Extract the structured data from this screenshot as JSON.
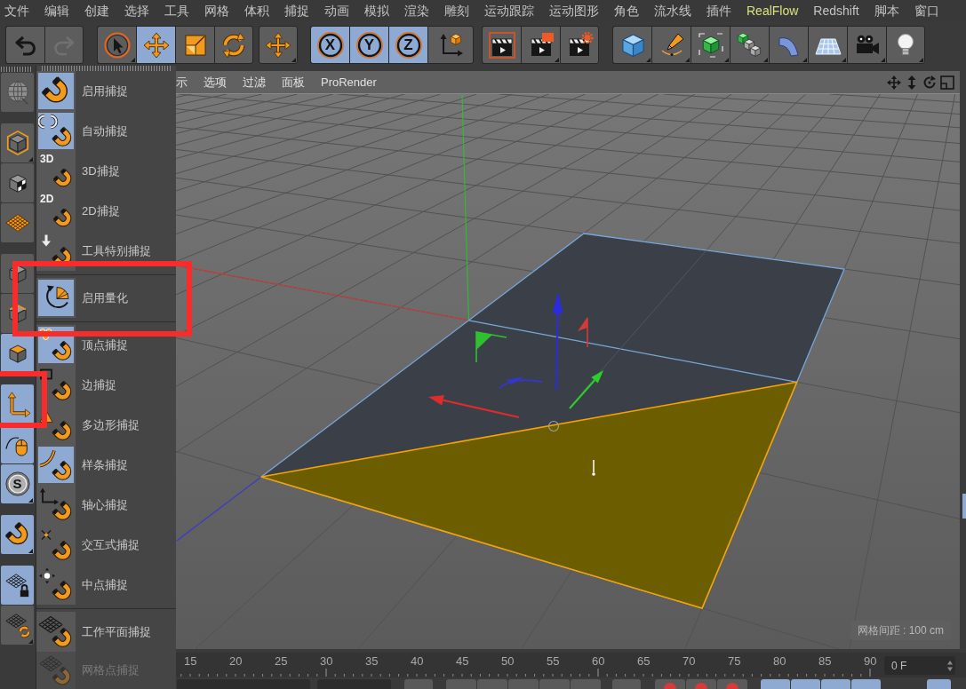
{
  "menu_bar": [
    {
      "label": "文件"
    },
    {
      "label": "编辑"
    },
    {
      "label": "创建"
    },
    {
      "label": "选择"
    },
    {
      "label": "工具"
    },
    {
      "label": "网格"
    },
    {
      "label": "体积"
    },
    {
      "label": "捕捉"
    },
    {
      "label": "动画"
    },
    {
      "label": "模拟"
    },
    {
      "label": "渲染"
    },
    {
      "label": "雕刻"
    },
    {
      "label": "运动跟踪"
    },
    {
      "label": "运动图形"
    },
    {
      "label": "角色"
    },
    {
      "label": "流水线"
    },
    {
      "label": "插件"
    },
    {
      "label": "RealFlow",
      "color": "#d8e27e"
    },
    {
      "label": "Redshift"
    },
    {
      "label": "脚本"
    },
    {
      "label": "窗口"
    }
  ],
  "toolbar": [
    {
      "buttons": [
        {
          "kind": "undo",
          "selected": false,
          "disabled": false,
          "submenu": false
        },
        {
          "kind": "redo",
          "selected": false,
          "disabled": true,
          "submenu": false
        }
      ]
    },
    {
      "buttons": [
        {
          "kind": "select",
          "selected": false,
          "disabled": false,
          "submenu": true
        },
        {
          "kind": "move",
          "selected": true,
          "disabled": false,
          "submenu": false
        },
        {
          "kind": "scale",
          "selected": false,
          "disabled": false,
          "submenu": false
        },
        {
          "kind": "rotate",
          "selected": false,
          "disabled": false,
          "submenu": false
        }
      ]
    },
    {
      "buttons": [
        {
          "kind": "transform",
          "selected": false,
          "disabled": false,
          "submenu": true
        }
      ]
    },
    {
      "buttons": [
        {
          "kind": "axis_lock",
          "label": "X",
          "selected": true,
          "disabled": false,
          "submenu": false
        },
        {
          "kind": "axis_lock",
          "label": "Y",
          "selected": true,
          "disabled": false,
          "submenu": false
        },
        {
          "kind": "axis_lock",
          "label": "Z",
          "selected": true,
          "disabled": false,
          "submenu": false
        },
        {
          "kind": "coords",
          "selected": false,
          "disabled": false,
          "submenu": false
        }
      ]
    },
    {
      "buttons": [
        {
          "kind": "render_view",
          "selected": false,
          "disabled": false,
          "submenu": false
        },
        {
          "kind": "render_viewer",
          "selected": false,
          "disabled": false,
          "submenu": true
        },
        {
          "kind": "render_settings",
          "selected": false,
          "disabled": false,
          "submenu": false
        }
      ]
    },
    {
      "buttons": [
        {
          "kind": "cube",
          "selected": false,
          "disabled": false,
          "submenu": true
        },
        {
          "kind": "pen",
          "selected": false,
          "disabled": false,
          "submenu": true
        },
        {
          "kind": "subdivision",
          "selected": false,
          "disabled": false,
          "submenu": true
        },
        {
          "kind": "cloner",
          "selected": false,
          "disabled": false,
          "submenu": true
        },
        {
          "kind": "deformer",
          "selected": false,
          "disabled": false,
          "submenu": true
        },
        {
          "kind": "floor",
          "selected": false,
          "disabled": false,
          "submenu": true
        },
        {
          "kind": "camera",
          "selected": false,
          "disabled": false,
          "submenu": true
        },
        {
          "kind": "light",
          "selected": false,
          "disabled": false,
          "submenu": true
        }
      ]
    }
  ],
  "palette": {
    "items": [
      {
        "kind": "globe",
        "selected": false,
        "submenu": false,
        "highlighted": false
      },
      {
        "kind": "separator"
      },
      {
        "kind": "model",
        "selected": false,
        "submenu": true,
        "highlighted": false
      },
      {
        "kind": "texture",
        "selected": false,
        "submenu": false,
        "highlighted": false
      },
      {
        "kind": "workplane",
        "selected": false,
        "submenu": false,
        "highlighted": false
      },
      {
        "kind": "separator"
      },
      {
        "kind": "points",
        "selected": false,
        "submenu": false,
        "highlighted": false
      },
      {
        "kind": "edges",
        "selected": false,
        "submenu": false,
        "highlighted": false
      },
      {
        "kind": "polygons",
        "selected": true,
        "submenu": false,
        "highlighted": false
      },
      {
        "kind": "separator"
      },
      {
        "kind": "axis",
        "selected": true,
        "submenu": false,
        "highlighted": true
      },
      {
        "kind": "tweak",
        "selected": true,
        "submenu": false,
        "highlighted": false
      },
      {
        "kind": "solo",
        "label": "S",
        "selected": true,
        "submenu": true,
        "highlighted": false
      },
      {
        "kind": "separator"
      },
      {
        "kind": "snap",
        "selected": true,
        "submenu": true,
        "highlighted": false
      },
      {
        "kind": "separator"
      },
      {
        "kind": "workplane_lock",
        "selected": true,
        "submenu": false,
        "highlighted": false
      },
      {
        "kind": "quantize_grid",
        "selected": false,
        "submenu": true,
        "highlighted": false
      }
    ]
  },
  "snap_menu": {
    "items": [
      {
        "kind": "snap",
        "label": "启用捕捉",
        "selected": true,
        "disabled": false,
        "highlighted": false
      },
      {
        "kind": "auto",
        "label": "自动捕捉",
        "selected": true,
        "disabled": false,
        "highlighted": false
      },
      {
        "kind": "three_d",
        "label": "3D捕捉",
        "badge": "3D",
        "selected": false,
        "disabled": false,
        "highlighted": false
      },
      {
        "kind": "two_d",
        "label": "2D捕捉",
        "badge": "2D",
        "selected": false,
        "disabled": false,
        "highlighted": false
      },
      {
        "kind": "tool",
        "label": "工具特别捕捉",
        "selected": false,
        "disabled": false,
        "highlighted": false
      },
      {
        "kind": "separator"
      },
      {
        "kind": "quantize",
        "label": "启用量化",
        "selected": true,
        "disabled": false,
        "highlighted": true
      },
      {
        "kind": "separator"
      },
      {
        "kind": "vertex",
        "label": "顶点捕捉",
        "selected": true,
        "disabled": false,
        "highlighted": false
      },
      {
        "kind": "edge",
        "label": "边捕捉",
        "selected": false,
        "disabled": false,
        "highlighted": false
      },
      {
        "kind": "polygon",
        "label": "多边形捕捉",
        "selected": false,
        "disabled": false,
        "highlighted": false
      },
      {
        "kind": "spline",
        "label": "样条捕捉",
        "selected": true,
        "disabled": false,
        "highlighted": false
      },
      {
        "kind": "axis",
        "label": "轴心捕捉",
        "selected": false,
        "disabled": false,
        "highlighted": false
      },
      {
        "kind": "intersection",
        "label": "交互式捕捉",
        "selected": false,
        "disabled": false,
        "highlighted": false
      },
      {
        "kind": "midpoint",
        "label": "中点捕捉",
        "selected": false,
        "disabled": false,
        "highlighted": false
      },
      {
        "kind": "separator"
      },
      {
        "kind": "workplane",
        "label": "工作平面捕捉",
        "selected": false,
        "disabled": false,
        "highlighted": false
      },
      {
        "kind": "gridpoint",
        "label": "网格点捕捉",
        "selected": false,
        "disabled": true,
        "highlighted": false
      }
    ]
  },
  "viewport": {
    "menu": [
      "示",
      "选项",
      "过滤",
      "面板",
      "ProRender"
    ],
    "grid_spacing": "网格间距 : 100 cm"
  },
  "timeline": {
    "ticks": [
      "15",
      "20",
      "25",
      "30",
      "35",
      "40",
      "45",
      "50",
      "55",
      "60",
      "65",
      "70",
      "75",
      "80",
      "85",
      "90"
    ],
    "current_frame": "0 F"
  }
}
